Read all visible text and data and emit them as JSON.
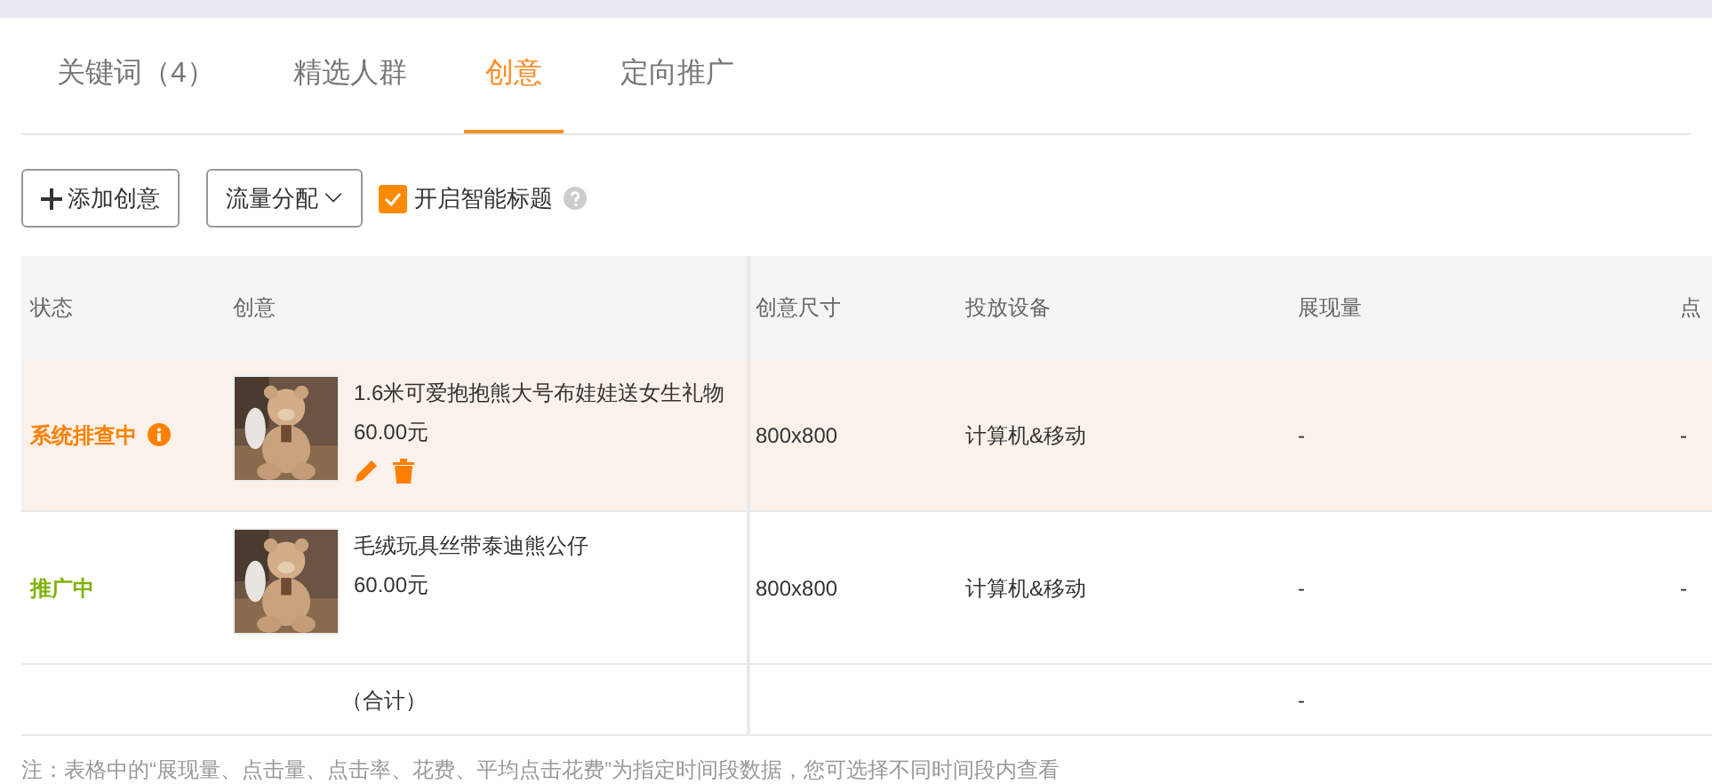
{
  "tabs": [
    {
      "label": "关键词（4）",
      "selected": false
    },
    {
      "label": "精选人群",
      "selected": false
    },
    {
      "label": "创意",
      "selected": true
    },
    {
      "label": "定向推广",
      "selected": false
    }
  ],
  "toolbar": {
    "add_button": "添加创意",
    "traffic_dropdown": "流量分配",
    "smart_title": {
      "label": "开启智能标题",
      "checked": true
    }
  },
  "table": {
    "columns": [
      "状态",
      "创意",
      "创意尺寸",
      "投放设备",
      "展现量",
      "点"
    ],
    "rows": [
      {
        "status": "系统排查中",
        "color": "#ff8000",
        "status_info": true,
        "highlighted": true,
        "title": "1.6米可爱抱抱熊大号布娃娃送女生礼物",
        "price": "60.00元",
        "editable": true,
        "size": "800x800",
        "device": "计算机&移动",
        "impressions": "-",
        "column_6": "-"
      },
      {
        "status": "推广中",
        "color": "#7fb300",
        "status_info": false,
        "highlighted": false,
        "title": "毛绒玩具丝带泰迪熊公仔",
        "price": "60.00元",
        "editable": false,
        "size": "800x800",
        "device": "计算机&移动",
        "impressions": "-",
        "column_6": "-"
      }
    ],
    "total": {
      "label": "（合计）",
      "impressions": "-"
    }
  },
  "note": "注：表格中的“展现量、点击量、点击率、花费、平均点击花费”为指定时间段数据，您可选择不同时间段内查看"
}
